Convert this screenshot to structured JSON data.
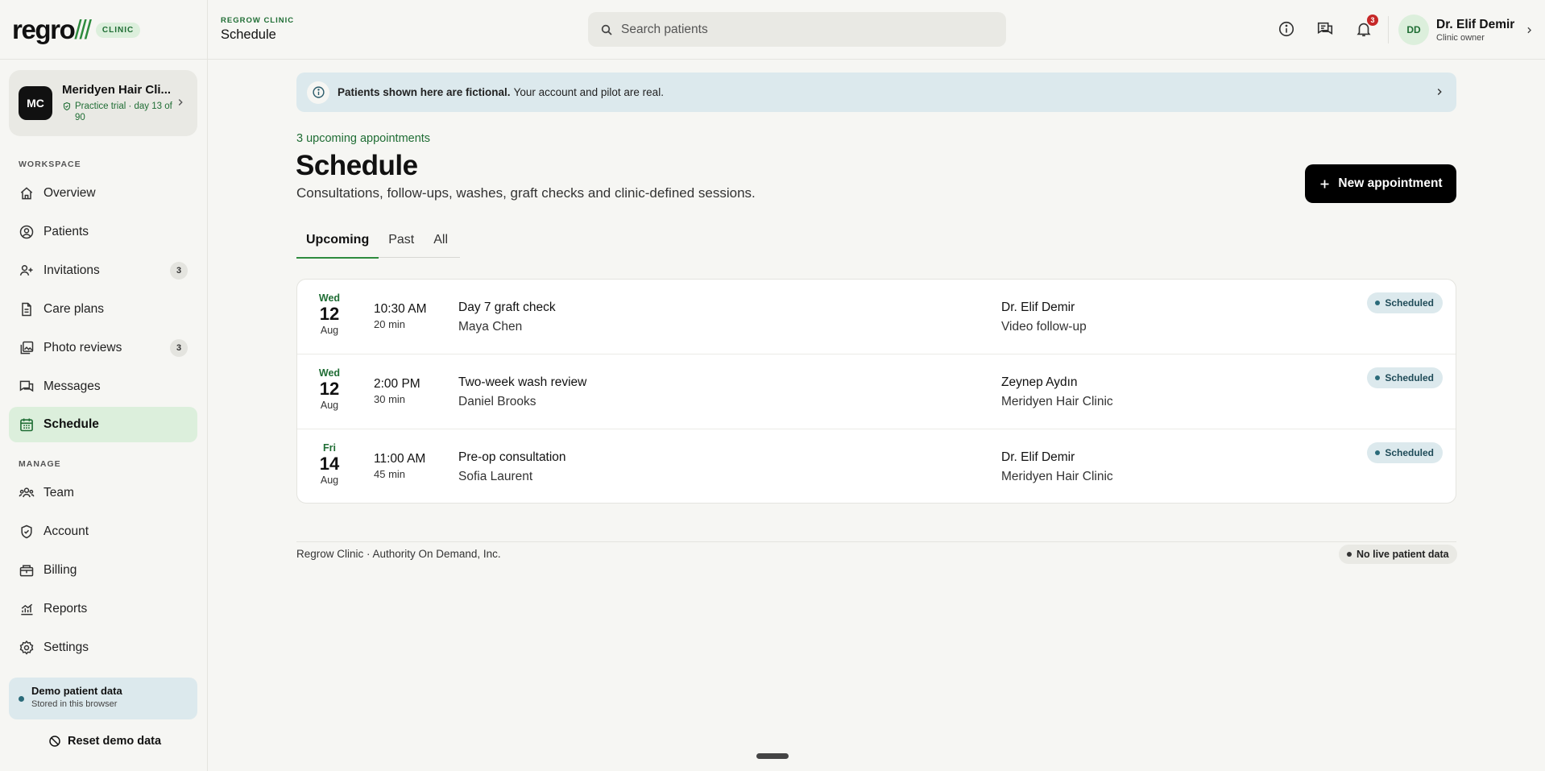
{
  "brand": {
    "logo_text": "regro",
    "logo_accent": "///",
    "badge": "CLINIC"
  },
  "clinic": {
    "initials": "MC",
    "name": "Meridyen Hair Cli...",
    "trial": "Practice trial · day 13 of 90"
  },
  "sidebar": {
    "workspace_label": "WORKSPACE",
    "manage_label": "MANAGE",
    "workspace_items": [
      {
        "label": "Overview",
        "icon": "home-icon"
      },
      {
        "label": "Patients",
        "icon": "user-circle-icon"
      },
      {
        "label": "Invitations",
        "icon": "user-plus-icon",
        "count": "3"
      },
      {
        "label": "Care plans",
        "icon": "document-icon"
      },
      {
        "label": "Photo reviews",
        "icon": "photos-icon",
        "count": "3"
      },
      {
        "label": "Messages",
        "icon": "chat-icon"
      },
      {
        "label": "Schedule",
        "icon": "calendar-icon",
        "active": true
      }
    ],
    "manage_items": [
      {
        "label": "Team",
        "icon": "team-icon"
      },
      {
        "label": "Account",
        "icon": "shield-check-icon"
      },
      {
        "label": "Billing",
        "icon": "billing-icon"
      },
      {
        "label": "Reports",
        "icon": "chart-icon"
      },
      {
        "label": "Settings",
        "icon": "gear-icon"
      }
    ],
    "demo": {
      "title": "Demo patient data",
      "subtitle": "Stored in this browser"
    },
    "reset_label": "Reset demo data"
  },
  "topbar": {
    "crumb_small": "REGROW CLINIC",
    "crumb_title": "Schedule",
    "search_placeholder": "Search patients",
    "notification_count": "3",
    "user": {
      "initials": "DD",
      "name": "Dr. Elif Demir",
      "role": "Clinic owner"
    }
  },
  "banner": {
    "bold": "Patients shown here are fictional.",
    "text": "Your account and pilot are real."
  },
  "main": {
    "upcoming_count": "3 upcoming appointments",
    "title": "Schedule",
    "subtitle": "Consultations, follow-ups, washes, graft checks and clinic-defined sessions.",
    "new_button": "New appointment",
    "tabs": [
      "Upcoming",
      "Past",
      "All"
    ],
    "active_tab": "Upcoming"
  },
  "appointments": [
    {
      "dow": "Wed",
      "day": "12",
      "month": "Aug",
      "time": "10:30 AM",
      "duration": "20 min",
      "title": "Day 7 graft check",
      "patient": "Maya Chen",
      "provider": "Dr. Elif Demir",
      "location": "Video follow-up",
      "status": "Scheduled"
    },
    {
      "dow": "Wed",
      "day": "12",
      "month": "Aug",
      "time": "2:00 PM",
      "duration": "30 min",
      "title": "Two-week wash review",
      "patient": "Daniel Brooks",
      "provider": "Zeynep Aydın",
      "location": "Meridyen Hair Clinic",
      "status": "Scheduled"
    },
    {
      "dow": "Fri",
      "day": "14",
      "month": "Aug",
      "time": "11:00 AM",
      "duration": "45 min",
      "title": "Pre-op consultation",
      "patient": "Sofia Laurent",
      "provider": "Dr. Elif Demir",
      "location": "Meridyen Hair Clinic",
      "status": "Scheduled"
    }
  ],
  "footer": {
    "text": "Regrow Clinic · Authority On Demand, Inc.",
    "badge": "No live patient data"
  },
  "colors": {
    "accent_green": "#2e8b3e",
    "active_bg": "#dcefdc",
    "info_bg": "#dce9ed",
    "primary_button": "#000000",
    "notification_red": "#c62828"
  }
}
